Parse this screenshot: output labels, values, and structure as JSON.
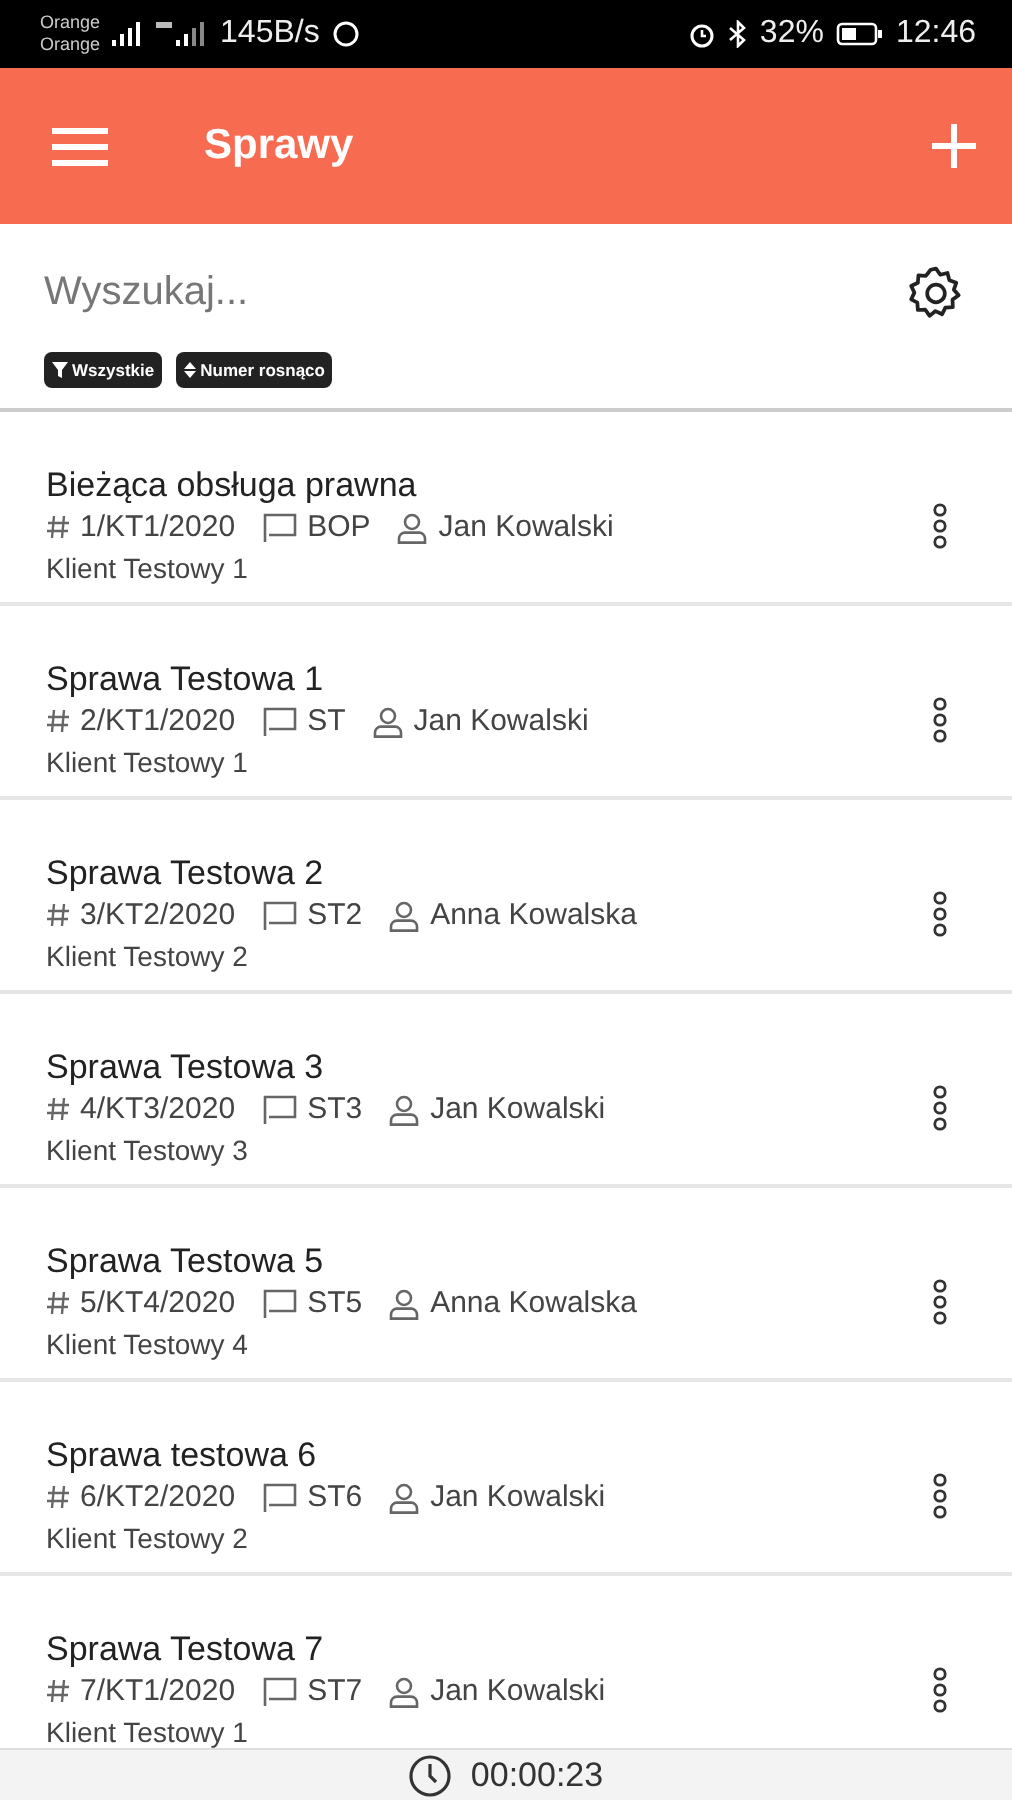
{
  "status_bar": {
    "carriers": [
      "Orange",
      "Orange"
    ],
    "speed": "145B/s",
    "battery": "32%",
    "time": "12:46"
  },
  "header": {
    "title": "Sprawy"
  },
  "search": {
    "placeholder": "Wyszukaj..."
  },
  "filters": [
    {
      "kind": "filter",
      "label": "Wszystkie"
    },
    {
      "kind": "sort",
      "label": "Numer rosnąco"
    }
  ],
  "cases": [
    {
      "title": "Bieżąca obsługa prawna",
      "number": "1/KT1/2020",
      "tag": "BOP",
      "person": "Jan Kowalski",
      "client": "Klient Testowy 1"
    },
    {
      "title": "Sprawa Testowa 1",
      "number": "2/KT1/2020",
      "tag": "ST",
      "person": "Jan Kowalski",
      "client": "Klient Testowy 1"
    },
    {
      "title": "Sprawa Testowa 2",
      "number": "3/KT2/2020",
      "tag": "ST2",
      "person": "Anna Kowalska",
      "client": "Klient Testowy 2"
    },
    {
      "title": "Sprawa Testowa 3",
      "number": "4/KT3/2020",
      "tag": "ST3",
      "person": "Jan Kowalski",
      "client": "Klient Testowy 3"
    },
    {
      "title": "Sprawa Testowa 5",
      "number": "5/KT4/2020",
      "tag": "ST5",
      "person": "Anna Kowalska",
      "client": "Klient Testowy 4"
    },
    {
      "title": "Sprawa testowa 6",
      "number": "6/KT2/2020",
      "tag": "ST6",
      "person": "Jan Kowalski",
      "client": "Klient Testowy 2"
    },
    {
      "title": "Sprawa Testowa 7",
      "number": "7/KT1/2020",
      "tag": "ST7",
      "person": "Jan Kowalski",
      "client": "Klient Testowy 1"
    }
  ],
  "timer": {
    "time": "00:00:23"
  }
}
